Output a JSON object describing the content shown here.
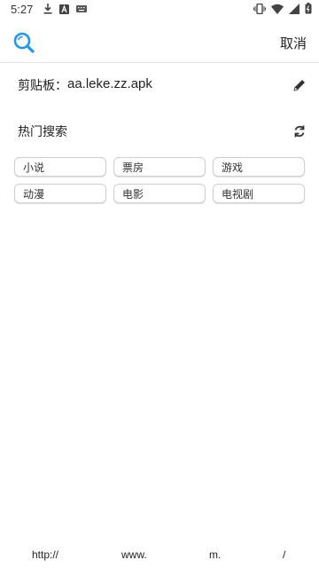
{
  "status_bar": {
    "time": "5:27"
  },
  "header": {
    "search_icon": "search-icon",
    "cancel_label": "取消",
    "accent": "#2196F3"
  },
  "clipboard": {
    "label": "剪贴板：",
    "value": "aa.leke.zz.apk",
    "edit_icon": "pencil-icon"
  },
  "hot_search": {
    "title": "热门搜索",
    "refresh_icon": "refresh-icon",
    "tags": [
      "小说",
      "票房",
      "游戏",
      "动漫",
      "电影",
      "电视剧"
    ]
  },
  "footer": {
    "parts": [
      "http://",
      "www.",
      "m.",
      "/"
    ]
  }
}
